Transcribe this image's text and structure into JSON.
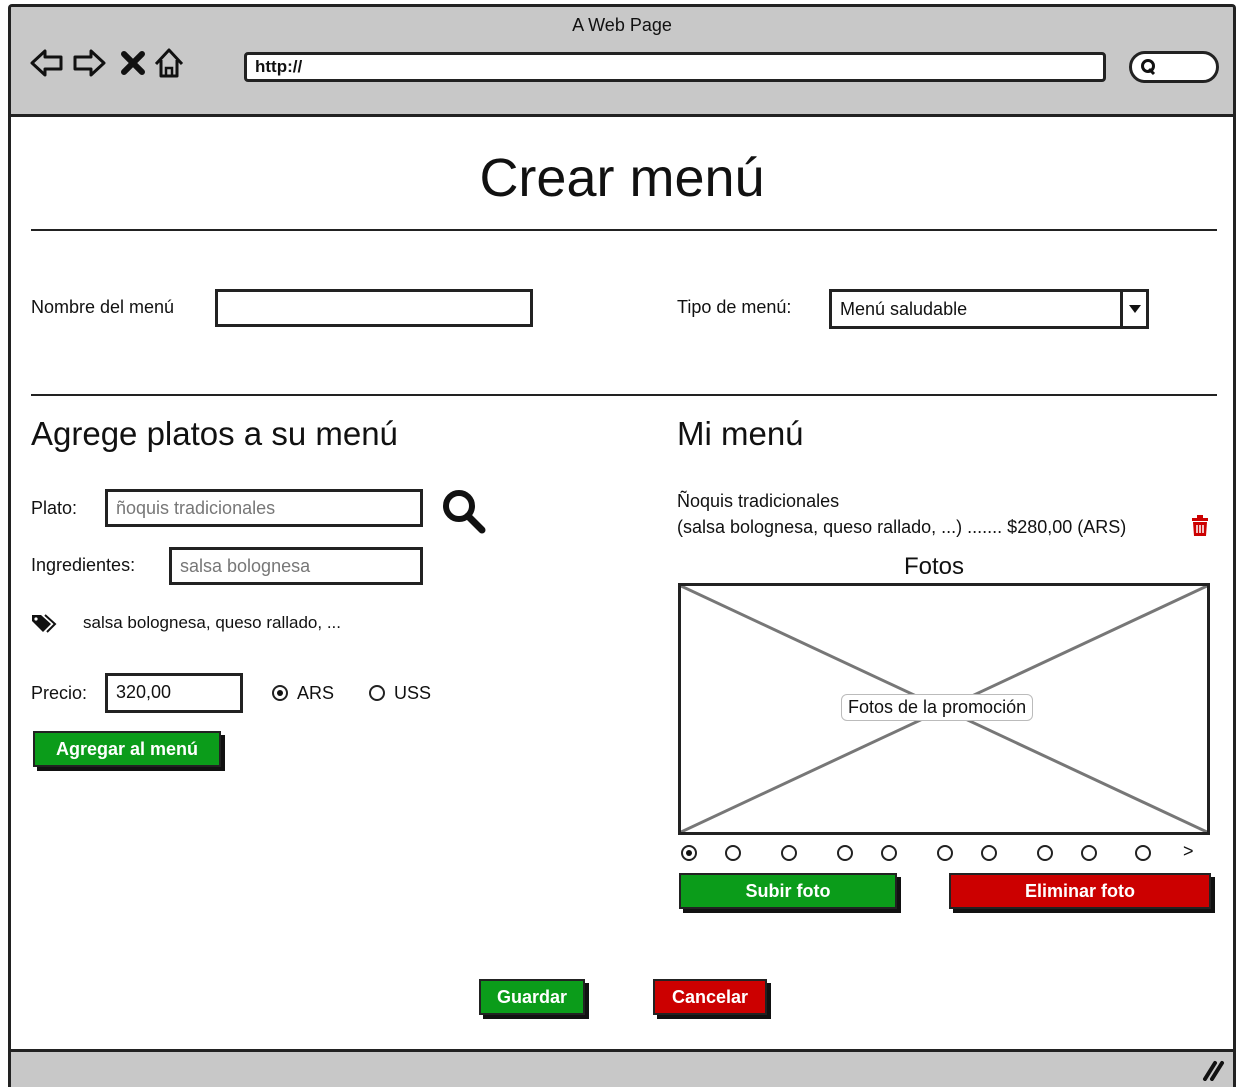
{
  "window": {
    "title": "A Web Page",
    "url": "http://"
  },
  "page": {
    "title": "Crear menú"
  },
  "form": {
    "menu_name_label": "Nombre del menú",
    "menu_name_value": "",
    "menu_type_label": "Tipo de menú:",
    "menu_type_value": "Menú saludable"
  },
  "add_section": {
    "heading": "Agrege platos a su menú",
    "plato_label": "Plato:",
    "plato_placeholder": "ñoquis tradicionales",
    "ingredientes_label": "Ingredientes:",
    "ingredientes_placeholder": "salsa bolognesa",
    "tags_text": "salsa bolognesa, queso rallado, ...",
    "precio_label": "Precio:",
    "precio_value": "320,00",
    "currency_options": [
      {
        "label": "ARS",
        "selected": true
      },
      {
        "label": "USS",
        "selected": false
      }
    ],
    "add_button": "Agregar al menú"
  },
  "my_menu": {
    "heading": "Mi menú",
    "item_name": "Ñoquis tradicionales",
    "item_detail": "(salsa bolognesa, queso rallado, ...) ....... $280,00 (ARS)",
    "photos_heading": "Fotos",
    "photo_caption": "Fotos de la promoción",
    "carousel_dots": 10,
    "carousel_selected": 1,
    "carousel_next": ">",
    "upload_button": "Subir foto",
    "delete_button": "Eliminar foto"
  },
  "actions": {
    "save": "Guardar",
    "cancel": "Cancelar"
  },
  "colors": {
    "green": "#0b9c1a",
    "red": "#cc0000",
    "chrome": "#c8c8c8"
  },
  "icons": [
    "back-arrow-icon",
    "forward-arrow-icon",
    "stop-icon",
    "home-icon",
    "search-icon",
    "tag-icon",
    "trash-icon",
    "resize-grip-icon"
  ]
}
